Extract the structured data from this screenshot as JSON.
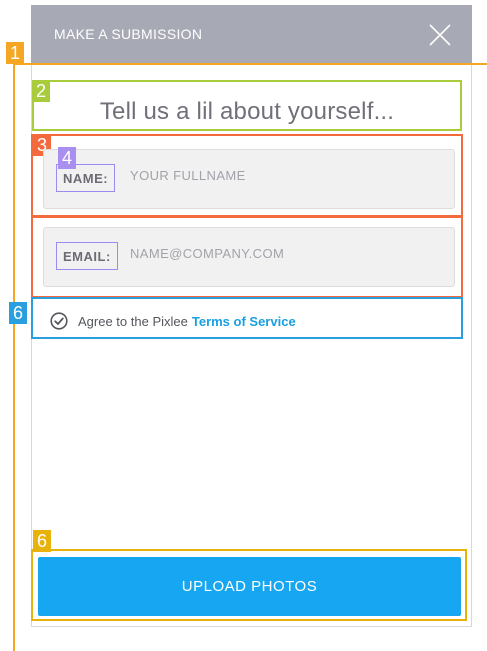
{
  "header": {
    "title": "MAKE A SUBMISSION",
    "close_icon": "close-icon"
  },
  "form": {
    "subtitle": "Tell us a lil about yourself...",
    "name_label": "NAME:",
    "name_placeholder": "YOUR FULLNAME",
    "email_label": "EMAIL:",
    "email_placeholder": "NAME@COMPANY.COM",
    "agree_text": "Agree to the Pixlee",
    "terms_link": "Terms of Service",
    "check_icon": "check-circle-icon",
    "upload_label": "UPLOAD PHOTOS"
  },
  "annotations": {
    "tags": [
      "1",
      "2",
      "3",
      "4",
      "6",
      "6"
    ],
    "colors": {
      "1": "#f5a623",
      "2": "#a8cc3c",
      "3": "#f26a3d",
      "4": "#a88ff0",
      "6_terms": "#2a9fe0",
      "6_button": "#e8b20b"
    }
  }
}
